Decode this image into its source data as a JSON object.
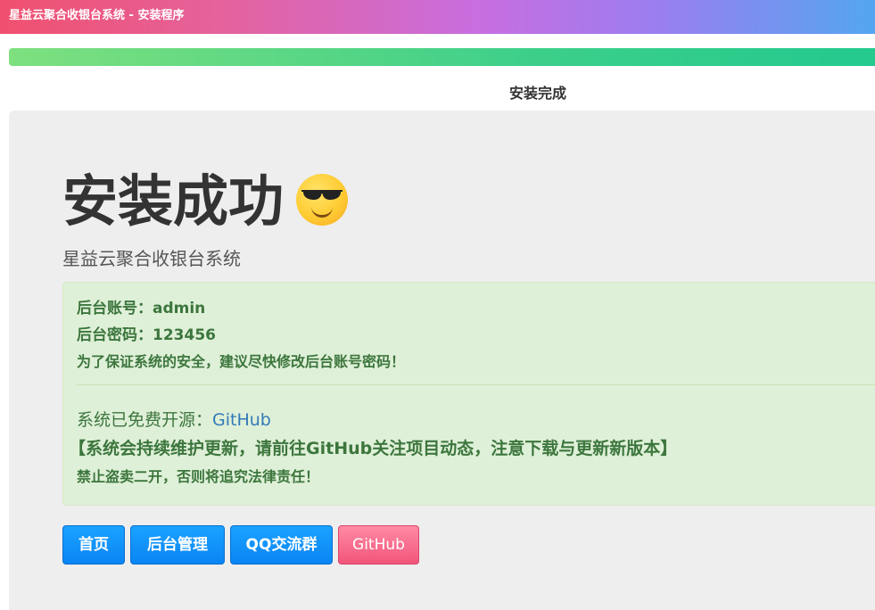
{
  "window": {
    "title": "星益云聚合收银台系统 - 安装程序"
  },
  "progress": {
    "percent": 100,
    "step_label": "安装完成"
  },
  "hero": {
    "title": "安装成功",
    "emoji_icon": "smiling-face-with-sunglasses-icon",
    "subtitle": "星益云聚合收银台系统"
  },
  "alert": {
    "account_line": "后台账号：admin",
    "password_line": "后台密码：123456",
    "warning_line": "为了保证系统的安全，建议尽快修改后台账号密码！",
    "opensource_prefix": "系统已免费开源：",
    "opensource_link": "GitHub",
    "maintain_notice": "【系统会持续维护更新，请前往GitHub关注项目动态，注意下载与更新新版本】",
    "prohibit_notice": "禁止盗卖二开，否则将追究法律责任！"
  },
  "buttons": {
    "home": "首页",
    "admin": "后台管理",
    "qq_group": "QQ交流群",
    "github": "GitHub"
  },
  "colors": {
    "progress_fill": "#3ccf8a",
    "alert_background": "#dff0d8",
    "alert_text": "#3c763d",
    "link": "#337ab7",
    "button_primary": "#0a84f5",
    "button_github": "#f2557a"
  }
}
